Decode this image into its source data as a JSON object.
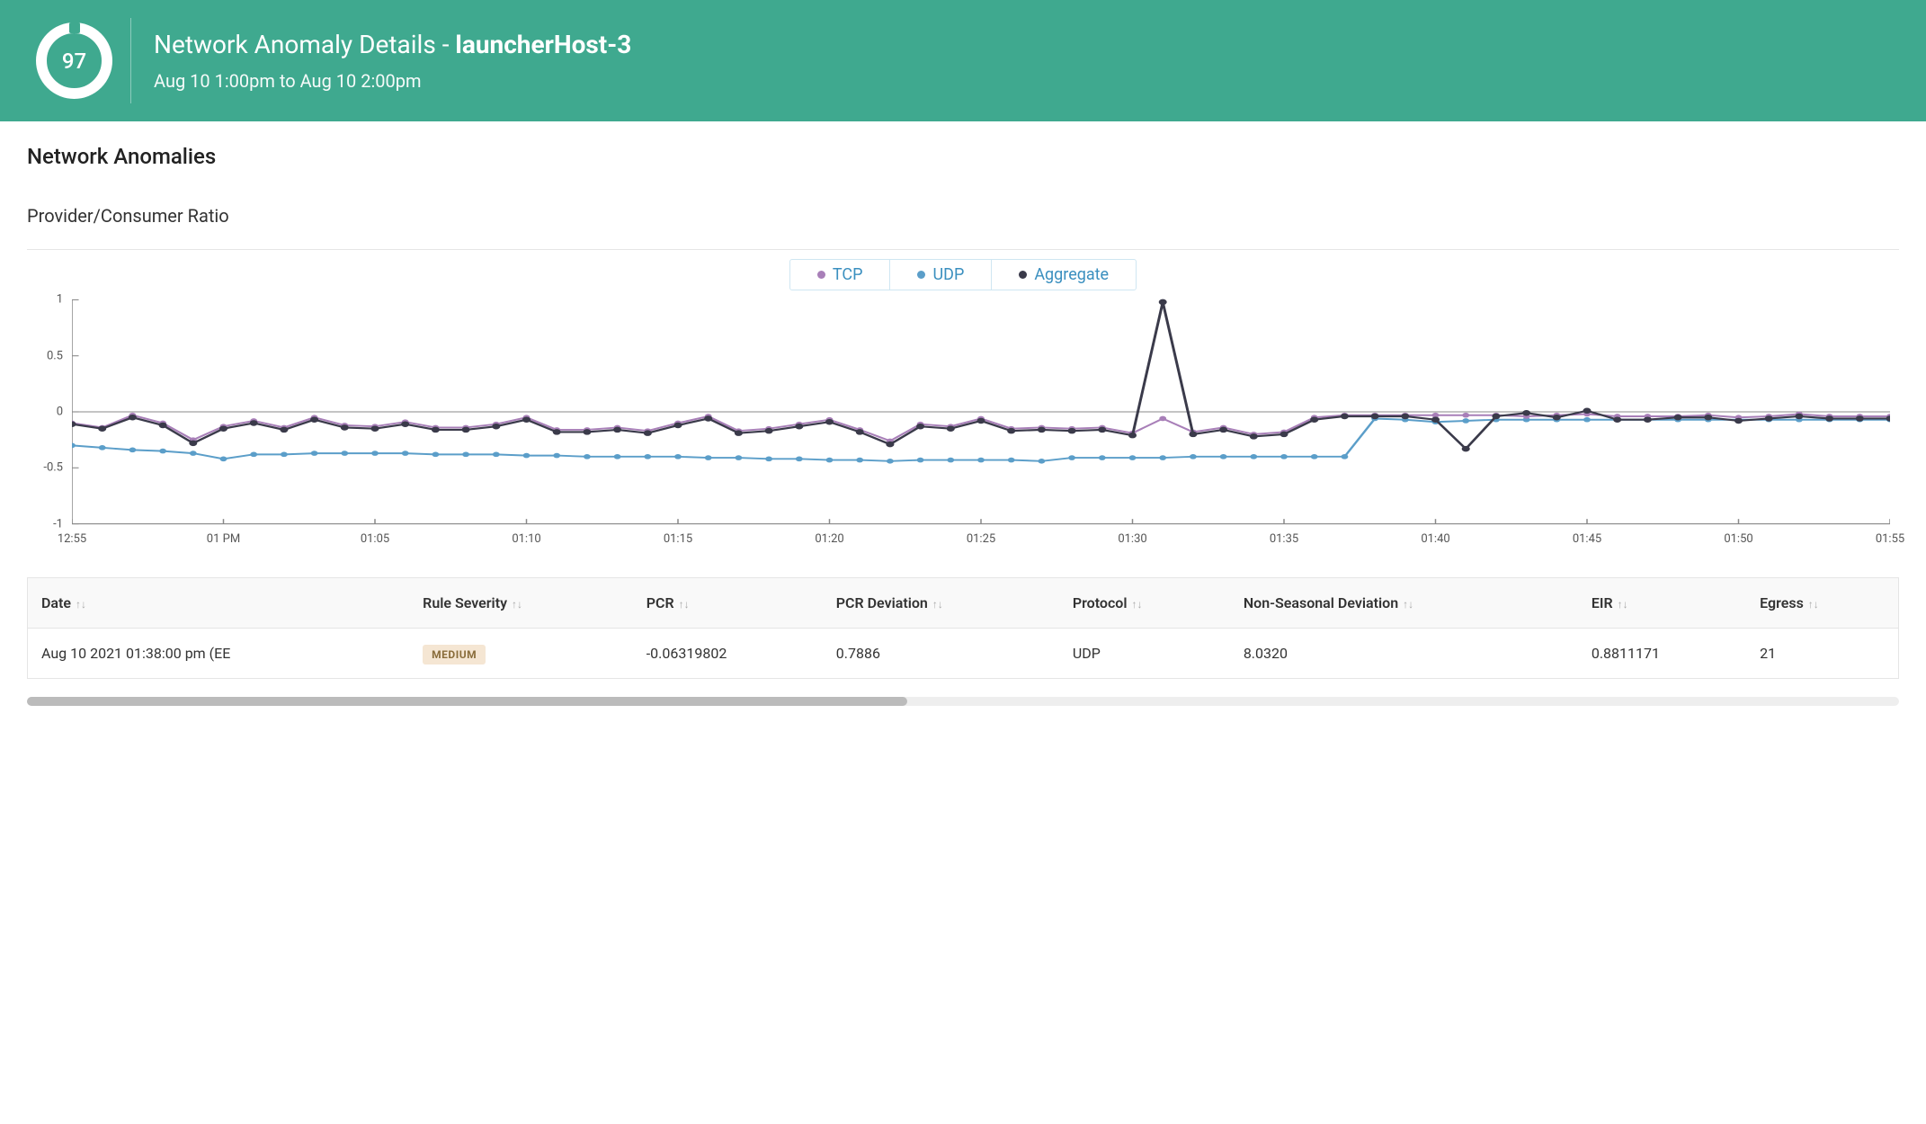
{
  "header": {
    "score": "97",
    "title_prefix": "Network Anomaly Details - ",
    "host": "launcherHost-3",
    "time_range": "Aug 10 1:00pm to Aug 10 2:00pm"
  },
  "section": {
    "title": "Network Anomalies",
    "subtitle": "Provider/Consumer Ratio"
  },
  "colors": {
    "tcp": "#a87fb8",
    "udp": "#5b9ec9",
    "aggregate": "#3a3a4a"
  },
  "chart_data": {
    "type": "line",
    "title": "",
    "xlabel": "",
    "ylabel": "",
    "ylim": [
      -1,
      1
    ],
    "y_ticks": [
      -1,
      -0.5,
      0,
      0.5,
      1
    ],
    "x_ticks": [
      "12:55",
      "01 PM",
      "01:05",
      "01:10",
      "01:15",
      "01:20",
      "01:25",
      "01:30",
      "01:35",
      "01:40",
      "01:45",
      "01:50",
      "01:55"
    ],
    "x_start_min": 55,
    "x_end_min": 115,
    "legend": [
      "TCP",
      "UDP",
      "Aggregate"
    ],
    "series": [
      {
        "name": "TCP",
        "color_key": "tcp",
        "x": [
          55,
          56,
          57,
          58,
          59,
          60,
          61,
          62,
          63,
          64,
          65,
          66,
          67,
          68,
          69,
          70,
          71,
          72,
          73,
          74,
          75,
          76,
          77,
          78,
          79,
          80,
          81,
          82,
          83,
          84,
          85,
          86,
          87,
          88,
          89,
          90,
          91,
          92,
          93,
          94,
          95,
          96,
          97,
          98,
          99,
          100,
          101,
          102,
          103,
          104,
          105,
          106,
          107,
          108,
          109,
          110,
          111,
          112,
          113,
          114,
          115
        ],
        "y": [
          -0.1,
          -0.14,
          -0.03,
          -0.1,
          -0.25,
          -0.13,
          -0.08,
          -0.14,
          -0.05,
          -0.12,
          -0.13,
          -0.09,
          -0.14,
          -0.14,
          -0.11,
          -0.05,
          -0.16,
          -0.16,
          -0.14,
          -0.17,
          -0.1,
          -0.04,
          -0.17,
          -0.15,
          -0.11,
          -0.07,
          -0.16,
          -0.26,
          -0.11,
          -0.13,
          -0.06,
          -0.15,
          -0.14,
          -0.15,
          -0.14,
          -0.19,
          -0.06,
          -0.18,
          -0.14,
          -0.2,
          -0.18,
          -0.05,
          -0.03,
          -0.03,
          -0.03,
          -0.03,
          -0.03,
          -0.03,
          -0.04,
          -0.03,
          -0.02,
          -0.04,
          -0.04,
          -0.04,
          -0.03,
          -0.05,
          -0.04,
          -0.02,
          -0.04,
          -0.04,
          -0.04
        ]
      },
      {
        "name": "UDP",
        "color_key": "udp",
        "x": [
          55,
          56,
          57,
          58,
          59,
          60,
          61,
          62,
          63,
          64,
          65,
          66,
          67,
          68,
          69,
          70,
          71,
          72,
          73,
          74,
          75,
          76,
          77,
          78,
          79,
          80,
          81,
          82,
          83,
          84,
          85,
          86,
          87,
          88,
          89,
          90,
          91,
          92,
          93,
          94,
          95,
          96,
          97,
          98,
          99,
          100,
          101,
          102,
          103,
          104,
          105,
          106,
          107,
          108,
          109,
          110,
          111,
          112,
          113,
          114,
          115
        ],
        "y": [
          -0.3,
          -0.32,
          -0.34,
          -0.35,
          -0.37,
          -0.42,
          -0.38,
          -0.38,
          -0.37,
          -0.37,
          -0.37,
          -0.37,
          -0.38,
          -0.38,
          -0.38,
          -0.39,
          -0.39,
          -0.4,
          -0.4,
          -0.4,
          -0.4,
          -0.41,
          -0.41,
          -0.42,
          -0.42,
          -0.43,
          -0.43,
          -0.44,
          -0.43,
          -0.43,
          -0.43,
          -0.43,
          -0.44,
          -0.41,
          -0.41,
          -0.41,
          -0.41,
          -0.4,
          -0.4,
          -0.4,
          -0.4,
          -0.4,
          -0.4,
          -0.06,
          -0.07,
          -0.09,
          -0.08,
          -0.07,
          -0.07,
          -0.07,
          -0.07,
          -0.07,
          -0.07,
          -0.07,
          -0.07,
          -0.07,
          -0.07,
          -0.07,
          -0.07,
          -0.07,
          -0.07
        ]
      },
      {
        "name": "Aggregate",
        "color_key": "aggregate",
        "x": [
          55,
          56,
          57,
          58,
          59,
          60,
          61,
          62,
          63,
          64,
          65,
          66,
          67,
          68,
          69,
          70,
          71,
          72,
          73,
          74,
          75,
          76,
          77,
          78,
          79,
          80,
          81,
          82,
          83,
          84,
          85,
          86,
          87,
          88,
          89,
          90,
          91,
          92,
          93,
          94,
          95,
          96,
          97,
          98,
          99,
          100,
          101,
          102,
          103,
          104,
          105,
          106,
          107,
          108,
          109,
          110,
          111,
          112,
          113,
          114,
          115
        ],
        "y": [
          -0.11,
          -0.15,
          -0.05,
          -0.12,
          -0.28,
          -0.15,
          -0.1,
          -0.16,
          -0.07,
          -0.14,
          -0.15,
          -0.11,
          -0.16,
          -0.16,
          -0.13,
          -0.07,
          -0.18,
          -0.18,
          -0.16,
          -0.19,
          -0.12,
          -0.06,
          -0.19,
          -0.17,
          -0.13,
          -0.09,
          -0.18,
          -0.29,
          -0.13,
          -0.15,
          -0.08,
          -0.17,
          -0.16,
          -0.17,
          -0.16,
          -0.21,
          0.98,
          -0.2,
          -0.16,
          -0.22,
          -0.2,
          -0.07,
          -0.04,
          -0.04,
          -0.04,
          -0.07,
          -0.33,
          -0.04,
          -0.01,
          -0.05,
          0.01,
          -0.07,
          -0.07,
          -0.05,
          -0.05,
          -0.08,
          -0.06,
          -0.04,
          -0.06,
          -0.06,
          -0.06
        ]
      }
    ]
  },
  "table": {
    "columns": [
      "Date",
      "Rule Severity",
      "PCR",
      "PCR Deviation",
      "Protocol",
      "Non-Seasonal Deviation",
      "EIR",
      "Egress"
    ],
    "rows": [
      {
        "date": "Aug 10 2021 01:38:00 pm (EE",
        "severity": "MEDIUM",
        "pcr": "-0.06319802",
        "pcr_dev": "0.7886",
        "protocol": "UDP",
        "non_seasonal": "8.0320",
        "eir": "0.8811171",
        "egress": "21"
      }
    ]
  }
}
